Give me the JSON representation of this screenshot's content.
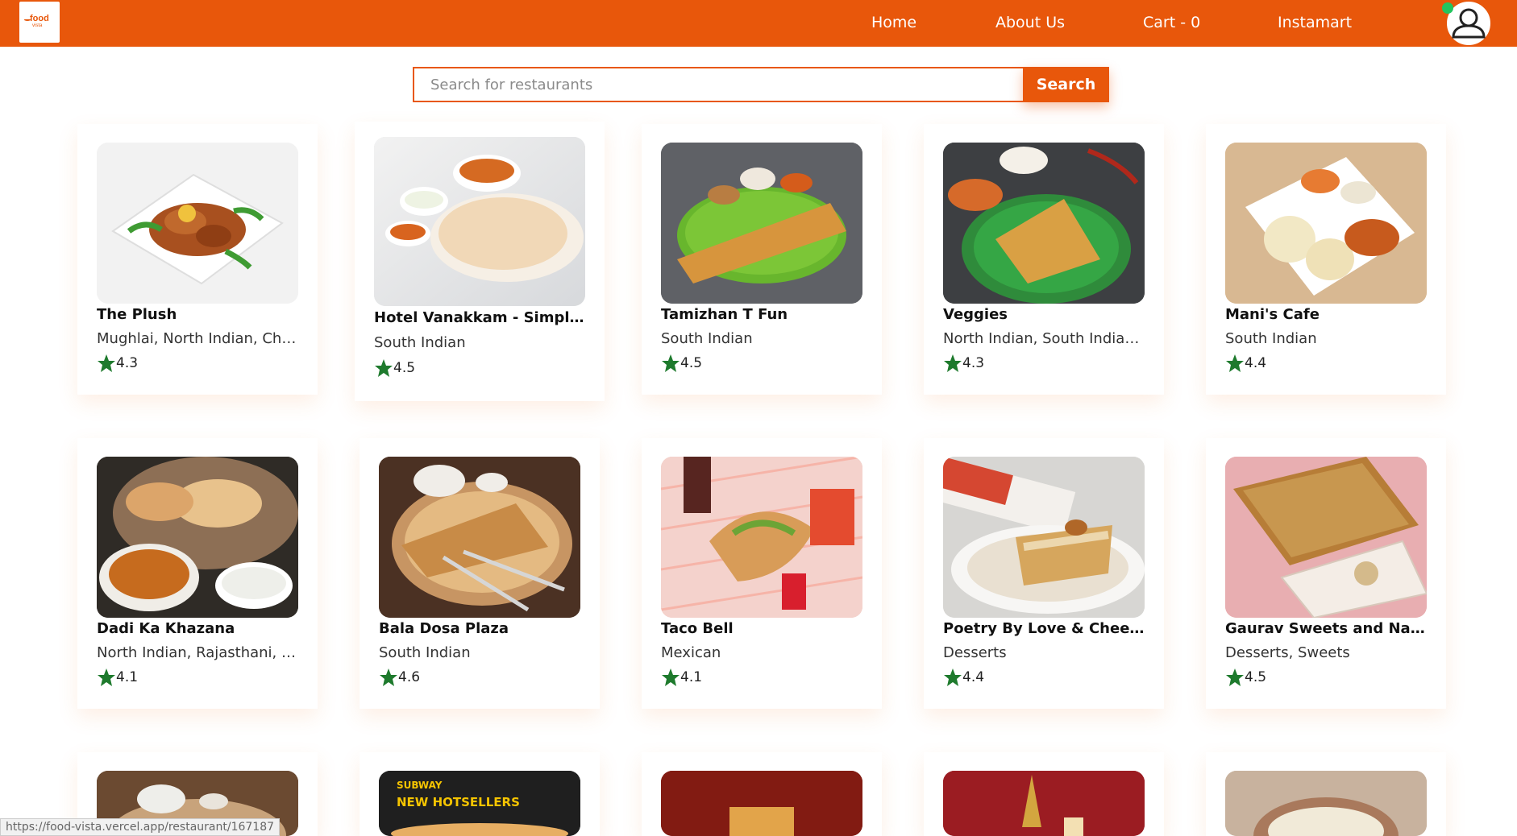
{
  "header": {
    "logo": {
      "line1": "food",
      "line2": "vista"
    },
    "nav": [
      {
        "label": "Home"
      },
      {
        "label": "About Us"
      },
      {
        "label": "Cart - 0"
      },
      {
        "label": "Instamart"
      }
    ],
    "online_color": "#22c55e",
    "brand_color": "#e8570b"
  },
  "search": {
    "placeholder": "Search for restaurants",
    "value": "",
    "button_label": "Search"
  },
  "restaurants": [
    {
      "name": "The Plush",
      "cuisine": "Mughlai, North Indian, Chin...",
      "rating": "4.3"
    },
    {
      "name": "Hotel Vanakkam - Simply T...",
      "cuisine": "South Indian",
      "rating": "4.5"
    },
    {
      "name": "Tamizhan T Fun",
      "cuisine": "South Indian",
      "rating": "4.5"
    },
    {
      "name": "Veggies",
      "cuisine": "North Indian, South Indian,...",
      "rating": "4.3"
    },
    {
      "name": "Mani's Cafe",
      "cuisine": "South Indian",
      "rating": "4.4"
    },
    {
      "name": "Dadi Ka Khazana",
      "cuisine": "North Indian, Rajasthani, T...",
      "rating": "4.1"
    },
    {
      "name": "Bala Dosa Plaza",
      "cuisine": "South Indian",
      "rating": "4.6"
    },
    {
      "name": "Taco Bell",
      "cuisine": "Mexican",
      "rating": "4.1"
    },
    {
      "name": "Poetry By Love & Cheeseca...",
      "cuisine": "Desserts",
      "rating": "4.4"
    },
    {
      "name": "Gaurav Sweets and Namke...",
      "cuisine": "Desserts, Sweets",
      "rating": "4.5"
    }
  ],
  "partial_cards": [
    {
      "image_text_top": "SUBWAY",
      "image_text_main": ""
    },
    {
      "image_text_top": "SUBWAY",
      "image_text_main": "NEW HOTSELLERS"
    }
  ],
  "status_bar": {
    "url": "https://food-vista.vercel.app/restaurant/167187"
  }
}
